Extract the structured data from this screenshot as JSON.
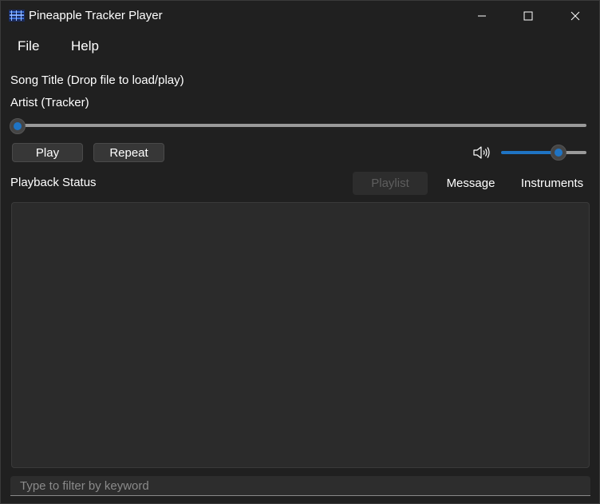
{
  "window": {
    "title": "Pineapple Tracker Player",
    "controls": {
      "minimize_icon": "minimize-icon",
      "maximize_icon": "maximize-icon",
      "close_icon": "close-icon"
    }
  },
  "menu": {
    "items": [
      {
        "label": "File"
      },
      {
        "label": "Help"
      }
    ]
  },
  "song": {
    "title": "Song Title (Drop file to load/play)",
    "artist": "Artist (Tracker)"
  },
  "seek": {
    "position_fraction": 0.0
  },
  "controls": {
    "play_label": "Play",
    "repeat_label": "Repeat",
    "volume_icon": "speaker-icon",
    "volume_fraction": 0.66
  },
  "status": {
    "text": "Playback Status"
  },
  "tabs": [
    {
      "label": "Playlist",
      "selected": true
    },
    {
      "label": "Message",
      "selected": false
    },
    {
      "label": "Instruments",
      "selected": false
    }
  ],
  "filter": {
    "placeholder": "Type to filter by keyword",
    "value": ""
  },
  "colors": {
    "accent": "#1f74c4",
    "background": "#202020",
    "pane": "#2b2b2b"
  }
}
